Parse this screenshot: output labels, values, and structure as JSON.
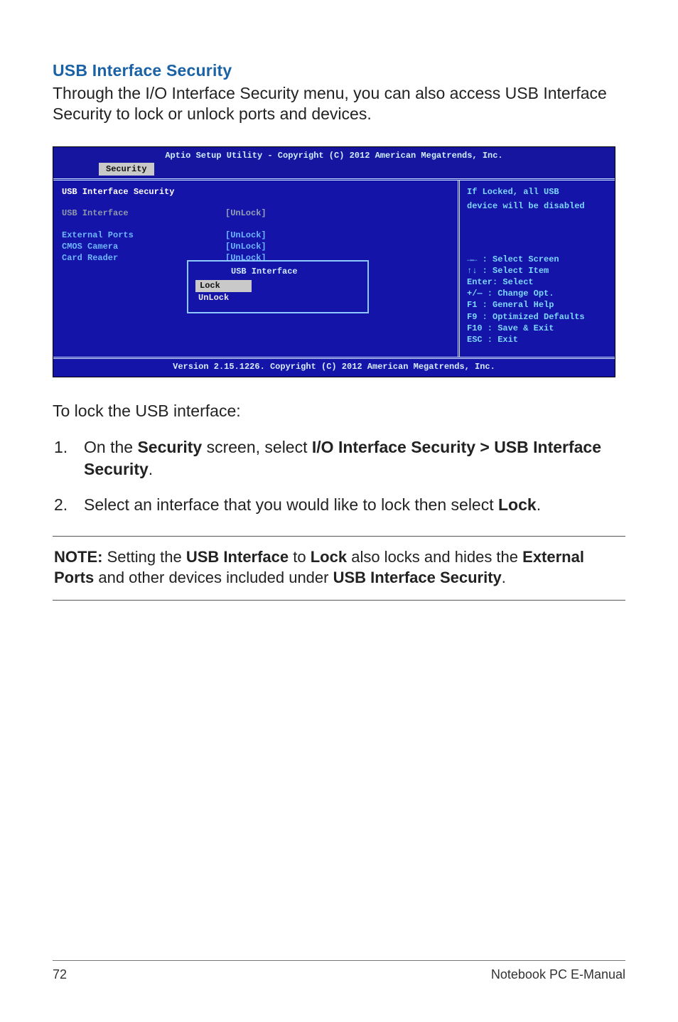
{
  "section": {
    "title": "USB Interface Security"
  },
  "lead": "Through the I/O Interface Security menu, you can also access USB Interface Security to lock or unlock ports and devices.",
  "bios": {
    "top": "Aptio Setup Utility - Copyright (C) 2012 American Megatrends, Inc.",
    "tab": "Security",
    "panel_title": "USB Interface Security",
    "rows": {
      "usb_if_lbl": "USB Interface",
      "usb_if_val": "[UnLock]",
      "ext_lbl": "External Ports",
      "ext_val": "[UnLock]",
      "cmos_lbl": "CMOS Camera",
      "cmos_val": "[UnLock]",
      "card_lbl": "Card Reader",
      "card_val": "[UnLock]"
    },
    "popup": {
      "title": "USB Interface",
      "opt1": "Lock",
      "opt2": "UnLock"
    },
    "right_title1": "If Locked, all USB",
    "right_title2": "device will be disabled",
    "help": {
      "l1": "→←   : Select Screen",
      "l2": "↑↓   : Select Item",
      "l3": "Enter: Select",
      "l4": "+/—  : Change Opt.",
      "l5": "F1   : General Help",
      "l6": "F9   : Optimized Defaults",
      "l7": "F10  : Save & Exit",
      "l8": "ESC  : Exit"
    },
    "foot": "Version 2.15.1226. Copyright (C) 2012 American Megatrends, Inc."
  },
  "after": "To lock the USB interface:",
  "steps": {
    "n1": "1.",
    "s1a": "On the ",
    "s1b": "Security",
    "s1c": " screen, select ",
    "s1d": "I/O Interface Security > USB Interface Security",
    "s1e": ".",
    "n2": "2.",
    "s2a": "Select an interface that you would like to lock then select ",
    "s2b": "Lock",
    "s2c": "."
  },
  "note": {
    "a": "NOTE:",
    "b": " Setting the ",
    "c": "USB Interface",
    "d": " to ",
    "e": "Lock",
    "f": " also locks and hides the ",
    "g": "External Ports",
    "h": " and other devices included under ",
    "i": "USB Interface Security",
    "j": "."
  },
  "footer": {
    "page": "72",
    "book": "Notebook PC E-Manual"
  }
}
